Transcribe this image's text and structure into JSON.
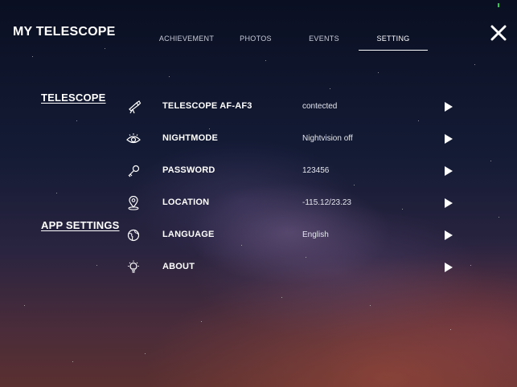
{
  "header": {
    "app_title": "MY TELESCOPE",
    "tabs": [
      {
        "label": "ACHIEVEMENT",
        "active": false
      },
      {
        "label": "PHOTOS",
        "active": false
      },
      {
        "label": "EVENTS",
        "active": false
      },
      {
        "label": "SETTING",
        "active": true
      }
    ],
    "close_icon": "close-x-icon"
  },
  "sections": {
    "telescope": "TELESCOPE",
    "app_settings": "APP SETTINGS"
  },
  "settings": [
    {
      "icon": "telescope-icon",
      "label": "TELESCOPE AF-AF3",
      "value": "contected"
    },
    {
      "icon": "eye-icon",
      "label": "NIGHTMODE",
      "value": "Nightvision off"
    },
    {
      "icon": "key-icon",
      "label": "PASSWORD",
      "value": "123456"
    },
    {
      "icon": "location-pin-icon",
      "label": "LOCATION",
      "value": "-115.12/23.23"
    },
    {
      "icon": "globe-icon",
      "label": "LANGUAGE",
      "value": "English"
    },
    {
      "icon": "lightbulb-icon",
      "label": "ABOUT",
      "value": ""
    }
  ],
  "colors": {
    "background_top": "#0a0f22",
    "background_bottom": "#5a3030",
    "signal": "#28d048"
  }
}
